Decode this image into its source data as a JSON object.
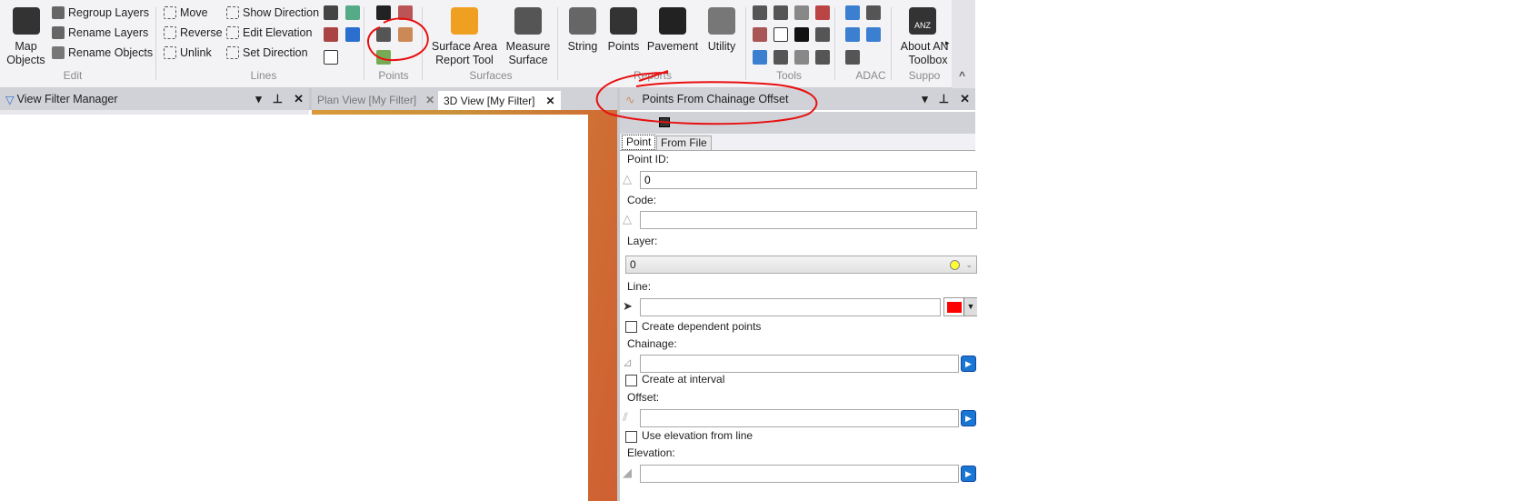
{
  "ribbon": {
    "edit": {
      "label": "Edit",
      "map_objects": "Map Objects",
      "regroup": "Regroup Layers",
      "rename_layers": "Rename Layers",
      "rename_objects": "Rename Objects"
    },
    "lines": {
      "label": "Lines",
      "move": "Move",
      "reverse": "Reverse",
      "unlink": "Unlink",
      "show_direction": "Show Direction",
      "edit_elevation": "Edit Elevation",
      "set_direction": "Set Direction"
    },
    "points": {
      "label": "Points"
    },
    "surfaces": {
      "label": "Surfaces",
      "surface_area": "Surface Area Report Tool",
      "measure": "Measure Surface"
    },
    "reports": {
      "label": "Reports",
      "string": "String",
      "points": "Points",
      "pavement": "Pavement",
      "utility": "Utility"
    },
    "tools": {
      "label": "Tools"
    },
    "adac": {
      "label": "ADAC"
    },
    "support": {
      "label": "Suppo",
      "about": "About ANZ Toolbox",
      "about_visible": "About A Toolbo",
      "anz_badge": "ANZ"
    }
  },
  "left_panel": {
    "title": "View Filter Manager"
  },
  "view_tabs": [
    {
      "label": "Plan View [My Filter]",
      "active": false
    },
    {
      "label": "3D View [My Filter]",
      "active": true
    }
  ],
  "tool_panel": {
    "title": "Points From Chainage Offset",
    "tabs": [
      "Point",
      "From File"
    ],
    "point_id_label": "Point ID:",
    "point_id_value": "0",
    "code_label": "Code:",
    "code_value": "",
    "layer_label": "Layer:",
    "layer_value": "0",
    "layer_color": "#ffff33",
    "line_label": "Line:",
    "line_value": "",
    "line_color": "#ff0000",
    "create_dependent": "Create dependent points",
    "chainage_label": "Chainage:",
    "chainage_value": "",
    "create_interval": "Create at interval",
    "offset_label": "Offset:",
    "offset_value": "",
    "use_elevation": "Use elevation from line",
    "elevation_label": "Elevation:",
    "elevation_value": ""
  },
  "annotation_color": "#e81010",
  "close_glyph": "✕",
  "pin_glyph": "⊥",
  "menu_glyph": "▾",
  "collapse_glyph": "^",
  "more_glyph": "▸"
}
